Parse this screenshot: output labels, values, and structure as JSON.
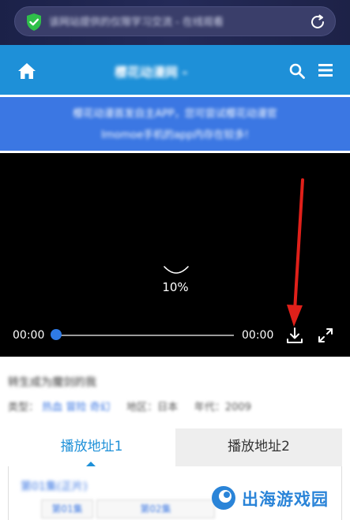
{
  "browser": {
    "url_text": "该网站提供的仅限学习交流 - 在线观看",
    "reload_icon": "reload-icon",
    "secure_icon": "shield-check-icon"
  },
  "header": {
    "title": "樱花动漫网 - ",
    "home_icon": "home-icon",
    "search_icon": "search-icon",
    "menu_icon": "menu-icon",
    "bg_color": "#1e90d8"
  },
  "notice": {
    "line1": "樱花动漫首发自主APP，您可尝试樱花动漫官",
    "line2": "Imomoe手机的app内存在较多!"
  },
  "player": {
    "loading_percent": "10%",
    "current_time": "00:00",
    "total_time": "00:00",
    "progress": 0,
    "download_icon": "download-icon",
    "fullscreen_icon": "fullscreen-icon",
    "accent_color": "#2f7be6"
  },
  "info": {
    "title": "转生成为魔剑的我",
    "meta_prefix": "类型：",
    "tags": [
      "热血",
      "冒险",
      "奇幻"
    ],
    "region": "地区：日本",
    "year": "年代：2009"
  },
  "tabs": {
    "items": [
      "播放地址1",
      "播放地址2"
    ],
    "active_index": 0
  },
  "episodes": {
    "label": "第01集(正片)",
    "buttons": [
      "第01集",
      "第02集"
    ]
  },
  "watermark": {
    "text": "出海游戏园"
  }
}
